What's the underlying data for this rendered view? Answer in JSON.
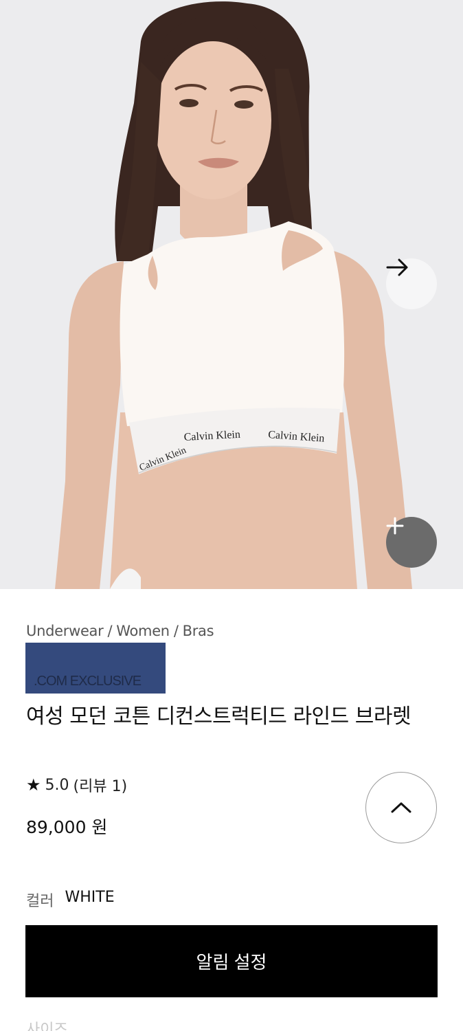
{
  "product_image": {
    "band_text_left": "Calvin Klein",
    "band_text_mid": "Calvin Klein",
    "band_text_right": "Calvin Klein"
  },
  "gallery": {
    "next_icon": "arrow-right-icon",
    "zoom_icon": "plus-icon"
  },
  "breadcrumb": [
    "Underwear",
    "Women",
    "Bras"
  ],
  "badge": ".COM EXCLUSIVE",
  "product": {
    "title": "여성 모던 코튼 디컨스트럭티드 라인드 브라렛",
    "rating": "5.0",
    "reviews": "(리뷰 1)",
    "price": "89,000 원"
  },
  "color": {
    "label": "컬러",
    "value": "WHITE"
  },
  "notify_button": "알림 설정",
  "size_label": "사이즈",
  "colors": {
    "badge_bg": "#344a7d",
    "button_bg": "#000000",
    "hero_bg": "#ececee"
  }
}
